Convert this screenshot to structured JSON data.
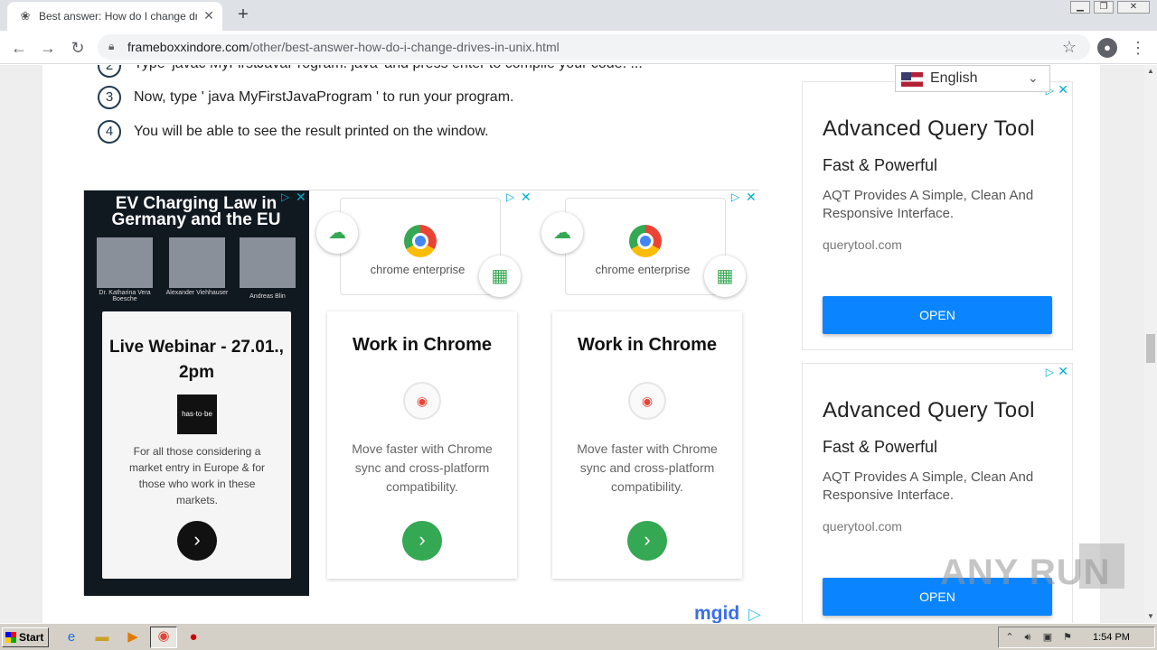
{
  "browser": {
    "tab_title": "Best answer: How do I change drive",
    "url_host": "frameboxxindore.com",
    "url_path": "/other/best-answer-how-do-i-change-drives-in-unix.html",
    "new_tab": "+",
    "tab_close": "✕"
  },
  "steps": [
    {
      "num": "2",
      "text": "Type 'javac MyFirstJavaProgram. java' and press enter to compile your code. ..."
    },
    {
      "num": "3",
      "text": "Now, type ' java MyFirstJavaProgram ' to run your program."
    },
    {
      "num": "4",
      "text": "You will be able to see the result printed on the window."
    }
  ],
  "ev_ad": {
    "title": "EV Charging Law in Germany and the EU",
    "people": [
      {
        "name": "Dr. Katharina Vera Boesche"
      },
      {
        "name": "Alexander Viehhauser"
      },
      {
        "name": "Andreas Blin"
      }
    ],
    "card_title": "Live Webinar - 27.01., 2pm",
    "logo_text": "has·to·be",
    "description": "For all those considering a market entry in Europe & for those who work in these markets.",
    "go_label": "›"
  },
  "chrome_ads": [
    {
      "banner_brand": "chrome enterprise",
      "title": "Work in Chrome",
      "description": "Move faster with Chrome sync and cross-platform compatibility.",
      "go_label": "›"
    },
    {
      "banner_brand": "chrome enterprise",
      "title": "Work in Chrome",
      "description": "Move faster with Chrome sync and cross-platform compatibility.",
      "go_label": "›"
    }
  ],
  "mgid_label": "mgid",
  "language": {
    "selected": "English"
  },
  "aqt_ads": [
    {
      "title": "Advanced Query Tool",
      "subtitle": "Fast & Powerful",
      "description": "AQT Provides A Simple, Clean And Responsive Interface.",
      "domain": "querytool.com",
      "button": "OPEN"
    },
    {
      "title": "Advanced Query Tool",
      "subtitle": "Fast & Powerful",
      "description": "AQT Provides A Simple, Clean And Responsive Interface.",
      "domain": "querytool.com",
      "button": "OPEN"
    }
  ],
  "watermark": "ANY RUN",
  "taskbar": {
    "start_label": "Start",
    "clock": "1:54 PM"
  },
  "colors": {
    "accent_blue": "#0a85ff",
    "chrome_green": "#34a853",
    "adchoice": "#00aecd"
  }
}
